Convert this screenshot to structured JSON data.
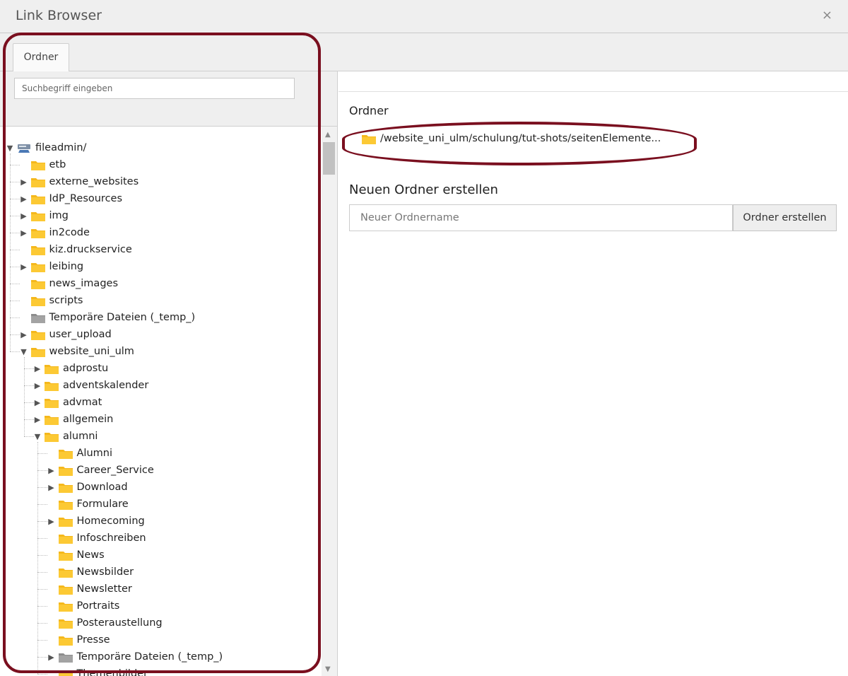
{
  "window": {
    "title": "Link Browser",
    "close_glyph": "×"
  },
  "tabs": [
    {
      "label": "Ordner",
      "active": true
    }
  ],
  "search": {
    "placeholder": "Suchbegriff eingeben",
    "value": ""
  },
  "tree": [
    {
      "label": "fileadmin/",
      "level": 0,
      "toggle": "expanded",
      "icon": "storage-icon"
    },
    {
      "label": "etb",
      "level": 1,
      "toggle": "none",
      "icon": "folder-icon"
    },
    {
      "label": "externe_websites",
      "level": 1,
      "toggle": "collapsed",
      "icon": "folder-icon"
    },
    {
      "label": "IdP_Resources",
      "level": 1,
      "toggle": "collapsed",
      "icon": "folder-icon"
    },
    {
      "label": "img",
      "level": 1,
      "toggle": "collapsed",
      "icon": "folder-icon"
    },
    {
      "label": "in2code",
      "level": 1,
      "toggle": "collapsed",
      "icon": "folder-icon"
    },
    {
      "label": "kiz.druckservice",
      "level": 1,
      "toggle": "none",
      "icon": "folder-icon"
    },
    {
      "label": "leibing",
      "level": 1,
      "toggle": "collapsed",
      "icon": "folder-icon"
    },
    {
      "label": "news_images",
      "level": 1,
      "toggle": "none",
      "icon": "folder-icon"
    },
    {
      "label": "scripts",
      "level": 1,
      "toggle": "none",
      "icon": "folder-icon"
    },
    {
      "label": "Temporäre Dateien (_temp_)",
      "level": 1,
      "toggle": "none",
      "icon": "temp-folder-icon"
    },
    {
      "label": "user_upload",
      "level": 1,
      "toggle": "collapsed",
      "icon": "folder-icon"
    },
    {
      "label": "website_uni_ulm",
      "level": 1,
      "toggle": "expanded",
      "icon": "folder-icon"
    },
    {
      "label": "adprostu",
      "level": 2,
      "toggle": "collapsed",
      "icon": "folder-icon"
    },
    {
      "label": "adventskalender",
      "level": 2,
      "toggle": "collapsed",
      "icon": "folder-icon"
    },
    {
      "label": "advmat",
      "level": 2,
      "toggle": "collapsed",
      "icon": "folder-icon"
    },
    {
      "label": "allgemein",
      "level": 2,
      "toggle": "collapsed",
      "icon": "folder-icon"
    },
    {
      "label": "alumni",
      "level": 2,
      "toggle": "expanded",
      "icon": "folder-icon"
    },
    {
      "label": "Alumni",
      "level": 3,
      "toggle": "none",
      "icon": "folder-icon"
    },
    {
      "label": "Career_Service",
      "level": 3,
      "toggle": "collapsed",
      "icon": "folder-icon"
    },
    {
      "label": "Download",
      "level": 3,
      "toggle": "collapsed",
      "icon": "folder-icon"
    },
    {
      "label": "Formulare",
      "level": 3,
      "toggle": "none",
      "icon": "folder-icon"
    },
    {
      "label": "Homecoming",
      "level": 3,
      "toggle": "collapsed",
      "icon": "folder-icon"
    },
    {
      "label": "Infoschreiben",
      "level": 3,
      "toggle": "none",
      "icon": "folder-icon"
    },
    {
      "label": "News",
      "level": 3,
      "toggle": "none",
      "icon": "folder-icon"
    },
    {
      "label": "Newsbilder",
      "level": 3,
      "toggle": "none",
      "icon": "folder-icon"
    },
    {
      "label": "Newsletter",
      "level": 3,
      "toggle": "none",
      "icon": "folder-icon"
    },
    {
      "label": "Portraits",
      "level": 3,
      "toggle": "none",
      "icon": "folder-icon"
    },
    {
      "label": "Posteraustellung",
      "level": 3,
      "toggle": "none",
      "icon": "folder-icon"
    },
    {
      "label": "Presse",
      "level": 3,
      "toggle": "none",
      "icon": "folder-icon"
    },
    {
      "label": "Temporäre Dateien (_temp_)",
      "level": 3,
      "toggle": "collapsed",
      "icon": "temp-folder-icon"
    },
    {
      "label": "Themenbilder",
      "level": 3,
      "toggle": "none",
      "icon": "folder-icon"
    }
  ],
  "right": {
    "folder_heading": "Ordner",
    "current_path": "/website_uni_ulm/schulung/tut-shots/seitenElemente...",
    "new_folder_heading": "Neuen Ordner erstellen",
    "new_folder_placeholder": "Neuer Ordnername",
    "new_folder_button": "Ordner erstellen"
  },
  "colors": {
    "annotation": "#7a0f1f",
    "folder": "#f5b81c",
    "temp_folder": "#8c8c8c"
  }
}
